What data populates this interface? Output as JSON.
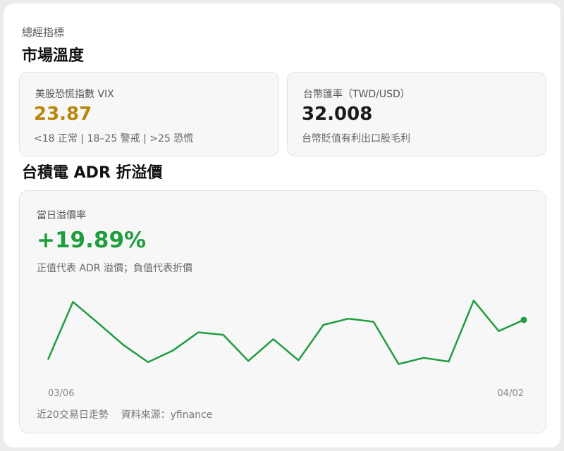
{
  "header": {
    "eyebrow": "總經指標",
    "title": "市場溫度"
  },
  "vix": {
    "label": "美股恐慌指數 VIX",
    "value": "23.87",
    "note": "<18 正常 | 18–25 警戒 | >25 恐慌",
    "value_color": "#b8860b"
  },
  "fx": {
    "label": "台幣匯率（TWD/USD）",
    "value": "32.008",
    "note": "台幣貶值有利出口股毛利"
  },
  "adr": {
    "section_title": "台積電 ADR 折溢價",
    "label": "當日溢價率",
    "value": "+19.89%",
    "value_color": "#1f9d3f",
    "note": "正值代表 ADR 溢價；負值代表折價",
    "footer": "近20交易日走勢    資料來源：yfinance"
  },
  "chart_data": {
    "type": "line",
    "x_ticks": [
      "03/06",
      "04/02"
    ],
    "series": [
      {
        "values": [
          9.6,
          18.9,
          15.5,
          12.0,
          9.2,
          11.1,
          14.0,
          13.6,
          9.4,
          12.9,
          9.5,
          15.2,
          16.2,
          15.7,
          8.9,
          9.9,
          9.3,
          19.1,
          14.2,
          16.0
        ]
      }
    ],
    "ylim": [
      5,
      22
    ],
    "line_color": "#1f9d3f",
    "grid": false
  }
}
